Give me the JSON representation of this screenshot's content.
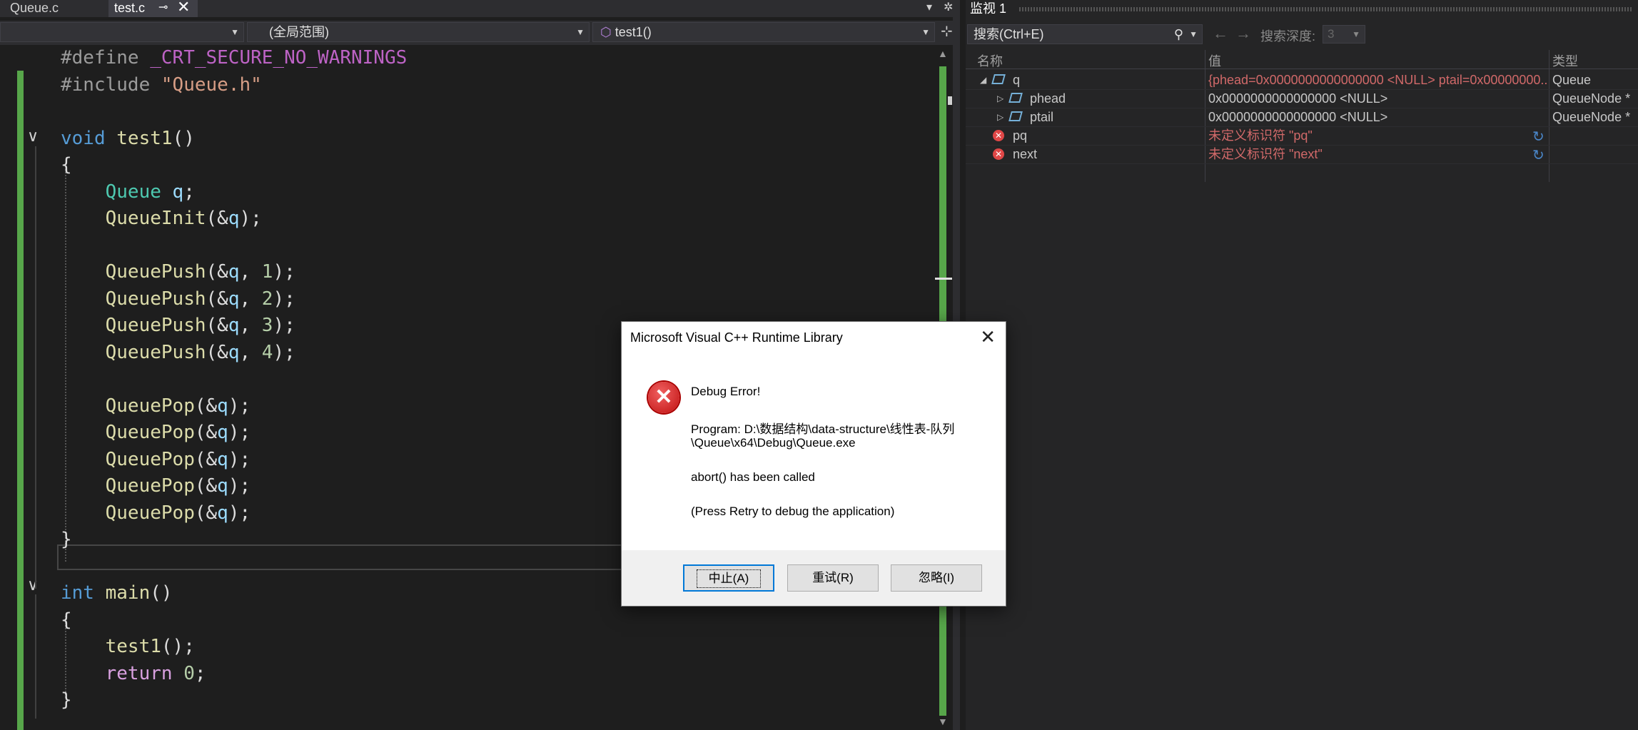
{
  "editor": {
    "tabs": [
      {
        "label": "Queue.c"
      },
      {
        "label": "test.c",
        "pin": "⊸",
        "close": "✕"
      }
    ],
    "tabstrip_menu": "▾",
    "tabstrip_gear": "✲",
    "navbar": {
      "project": "",
      "scope": "(全局范围)",
      "function": "test1()",
      "split": "⊹"
    },
    "code_lines": [
      {
        "tokens": [
          [
            "pp",
            "#define "
          ],
          [
            "macro",
            "_CRT_SECURE_NO_WARNINGS"
          ]
        ]
      },
      {
        "tokens": [
          [
            "pp",
            "#include "
          ],
          [
            "str",
            "\"Queue.h\""
          ]
        ]
      },
      {
        "tokens": []
      },
      {
        "tokens": [
          [
            "kw",
            "void "
          ],
          [
            "fn",
            "test1"
          ],
          [
            "pl",
            "()"
          ]
        ]
      },
      {
        "tokens": [
          [
            "pl",
            "{"
          ]
        ]
      },
      {
        "tokens": [
          [
            "pl",
            "    "
          ],
          [
            "ty",
            "Queue "
          ],
          [
            "var",
            "q"
          ],
          [
            "pl",
            ";"
          ]
        ]
      },
      {
        "tokens": [
          [
            "pl",
            "    "
          ],
          [
            "fn",
            "QueueInit"
          ],
          [
            "pl",
            "(&"
          ],
          [
            "var",
            "q"
          ],
          [
            "pl",
            ");"
          ]
        ]
      },
      {
        "tokens": []
      },
      {
        "tokens": [
          [
            "pl",
            "    "
          ],
          [
            "fn",
            "QueuePush"
          ],
          [
            "pl",
            "(&"
          ],
          [
            "var",
            "q"
          ],
          [
            "pl",
            ", "
          ],
          [
            "num",
            "1"
          ],
          [
            "pl",
            ");"
          ]
        ]
      },
      {
        "tokens": [
          [
            "pl",
            "    "
          ],
          [
            "fn",
            "QueuePush"
          ],
          [
            "pl",
            "(&"
          ],
          [
            "var",
            "q"
          ],
          [
            "pl",
            ", "
          ],
          [
            "num",
            "2"
          ],
          [
            "pl",
            ");"
          ]
        ]
      },
      {
        "tokens": [
          [
            "pl",
            "    "
          ],
          [
            "fn",
            "QueuePush"
          ],
          [
            "pl",
            "(&"
          ],
          [
            "var",
            "q"
          ],
          [
            "pl",
            ", "
          ],
          [
            "num",
            "3"
          ],
          [
            "pl",
            ");"
          ]
        ]
      },
      {
        "tokens": [
          [
            "pl",
            "    "
          ],
          [
            "fn",
            "QueuePush"
          ],
          [
            "pl",
            "(&"
          ],
          [
            "var",
            "q"
          ],
          [
            "pl",
            ", "
          ],
          [
            "num",
            "4"
          ],
          [
            "pl",
            ");"
          ]
        ]
      },
      {
        "tokens": []
      },
      {
        "tokens": [
          [
            "pl",
            "    "
          ],
          [
            "fn",
            "QueuePop"
          ],
          [
            "pl",
            "(&"
          ],
          [
            "var",
            "q"
          ],
          [
            "pl",
            ");"
          ]
        ]
      },
      {
        "tokens": [
          [
            "pl",
            "    "
          ],
          [
            "fn",
            "QueuePop"
          ],
          [
            "pl",
            "(&"
          ],
          [
            "var",
            "q"
          ],
          [
            "pl",
            ");"
          ]
        ]
      },
      {
        "tokens": [
          [
            "pl",
            "    "
          ],
          [
            "fn",
            "QueuePop"
          ],
          [
            "pl",
            "(&"
          ],
          [
            "var",
            "q"
          ],
          [
            "pl",
            ");"
          ]
        ]
      },
      {
        "tokens": [
          [
            "pl",
            "    "
          ],
          [
            "fn",
            "QueuePop"
          ],
          [
            "pl",
            "(&"
          ],
          [
            "var",
            "q"
          ],
          [
            "pl",
            ");"
          ]
        ]
      },
      {
        "tokens": [
          [
            "pl",
            "    "
          ],
          [
            "fn",
            "QueuePop"
          ],
          [
            "pl",
            "(&"
          ],
          [
            "var",
            "q"
          ],
          [
            "pl",
            ");"
          ]
        ]
      },
      {
        "tokens": [
          [
            "pl",
            "}"
          ]
        ]
      },
      {
        "tokens": []
      },
      {
        "tokens": [
          [
            "kw",
            "int "
          ],
          [
            "fn",
            "main"
          ],
          [
            "pl",
            "()"
          ]
        ]
      },
      {
        "tokens": [
          [
            "pl",
            "{"
          ]
        ]
      },
      {
        "tokens": [
          [
            "pl",
            "    "
          ],
          [
            "fn",
            "test1"
          ],
          [
            "pl",
            "();"
          ]
        ]
      },
      {
        "tokens": [
          [
            "pl",
            "    "
          ],
          [
            "ret",
            "return "
          ],
          [
            "num",
            "0"
          ],
          [
            "pl",
            ";"
          ]
        ]
      },
      {
        "tokens": [
          [
            "pl",
            "}"
          ]
        ]
      }
    ],
    "fold_glyph": "∨"
  },
  "watch": {
    "title": "监视 1",
    "search_placeholder": "搜索(Ctrl+E)",
    "search_icon": "⚲",
    "back_arrow": "←",
    "forward_arrow": "→",
    "depth_label": "搜索深度:",
    "depth_value": "3",
    "columns": {
      "name": "名称",
      "value": "值",
      "type": "类型"
    },
    "rows": [
      {
        "name": "q",
        "value": "{phead=0x0000000000000000 <NULL> ptail=0x00000000...",
        "type": "Queue",
        "kind": "object",
        "expander": "◢",
        "level": 0,
        "value_color": "#d16969"
      },
      {
        "name": "phead",
        "value": "0x0000000000000000 <NULL>",
        "type": "QueueNode *",
        "kind": "object",
        "expander": "▷",
        "level": 1,
        "value_color": "#c8c8c8"
      },
      {
        "name": "ptail",
        "value": "0x0000000000000000 <NULL>",
        "type": "QueueNode *",
        "kind": "object",
        "expander": "▷",
        "level": 1,
        "value_color": "#c8c8c8"
      },
      {
        "name": "pq",
        "value": "未定义标识符 \"pq\"",
        "type": "",
        "kind": "error",
        "expander": "",
        "level": 0,
        "value_color": "#d16969"
      },
      {
        "name": "next",
        "value": "未定义标识符 \"next\"",
        "type": "",
        "kind": "error",
        "expander": "",
        "level": 0,
        "value_color": "#d16969"
      }
    ],
    "refresh_glyph": "↻",
    "error_glyph": "✕"
  },
  "dialog": {
    "title": "Microsoft Visual C++ Runtime Library",
    "close": "✕",
    "icon": "✕",
    "heading": "Debug Error!",
    "program_line1": "Program: D:\\数据结构\\data-structure\\线性表-队列",
    "program_line2": "\\Queue\\x64\\Debug\\Queue.exe",
    "message": "abort() has been called",
    "hint": "(Press Retry to debug the application)",
    "buttons": {
      "abort": "中止(A)",
      "retry": "重试(R)",
      "ignore": "忽略(I)"
    }
  }
}
